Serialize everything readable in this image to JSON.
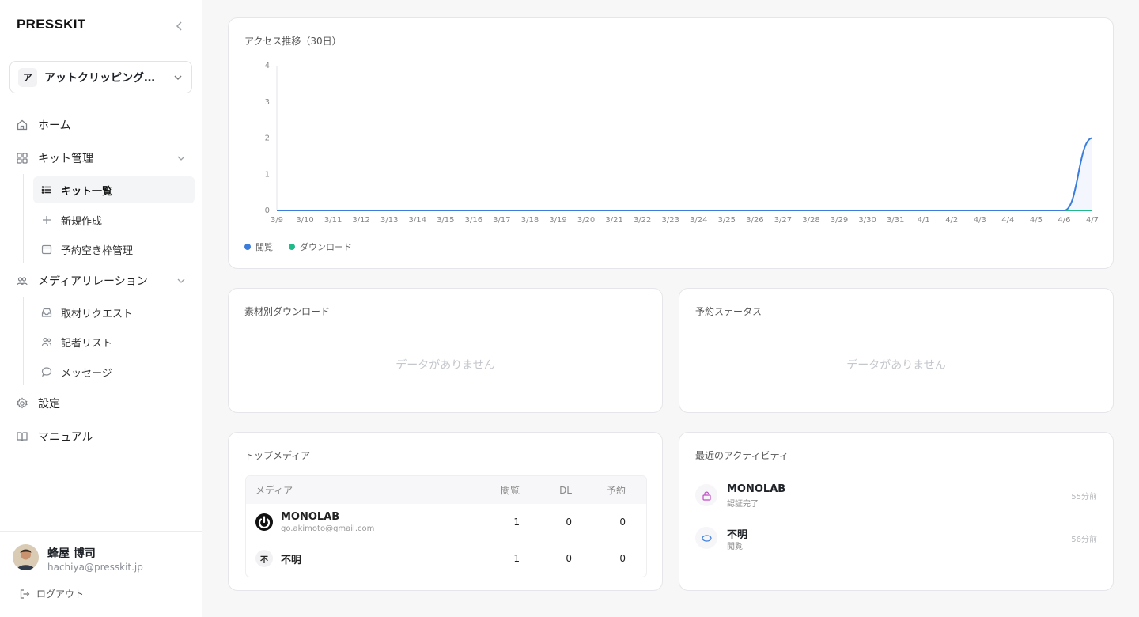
{
  "app": {
    "logo": "PRESSKIT"
  },
  "org": {
    "avatar": "ア",
    "name": "アットクリッピング株式会社"
  },
  "nav": {
    "home": "ホーム",
    "kit_management": "キット管理",
    "kit_list": "キット一覧",
    "new_kit": "新規作成",
    "booking_slots": "予約空き枠管理",
    "media_relations": "メディアリレーション",
    "coverage_requests": "取材リクエスト",
    "journalist_list": "記者リスト",
    "messages": "メッセージ",
    "settings": "設定",
    "manual": "マニュアル"
  },
  "user": {
    "name": "蜂屋 博司",
    "email": "hachiya@presskit.jp",
    "logout": "ログアウト"
  },
  "access_card": {
    "title": "アクセス推移（30日）",
    "legend_views": "閲覧",
    "legend_downloads": "ダウンロード"
  },
  "chart_data": {
    "type": "line",
    "title": "アクセス推移（30日）",
    "x": [
      "3/9",
      "3/10",
      "3/11",
      "3/12",
      "3/13",
      "3/14",
      "3/15",
      "3/16",
      "3/17",
      "3/18",
      "3/19",
      "3/20",
      "3/21",
      "3/22",
      "3/23",
      "3/24",
      "3/25",
      "3/26",
      "3/27",
      "3/28",
      "3/29",
      "3/30",
      "3/31",
      "4/1",
      "4/2",
      "4/3",
      "4/4",
      "4/5",
      "4/6",
      "4/7"
    ],
    "ylim": [
      0,
      4
    ],
    "yticks": [
      0,
      1,
      2,
      3,
      4
    ],
    "series": [
      {
        "name": "閲覧",
        "color": "#3b7ddd",
        "values": [
          0,
          0,
          0,
          0,
          0,
          0,
          0,
          0,
          0,
          0,
          0,
          0,
          0,
          0,
          0,
          0,
          0,
          0,
          0,
          0,
          0,
          0,
          0,
          0,
          0,
          0,
          0,
          0,
          0,
          2
        ]
      },
      {
        "name": "ダウンロード",
        "color": "#1fb98a",
        "values": [
          0,
          0,
          0,
          0,
          0,
          0,
          0,
          0,
          0,
          0,
          0,
          0,
          0,
          0,
          0,
          0,
          0,
          0,
          0,
          0,
          0,
          0,
          0,
          0,
          0,
          0,
          0,
          0,
          0,
          0
        ]
      }
    ],
    "grid": false,
    "legend": "bottom-left"
  },
  "downloads_card": {
    "title": "素材別ダウンロード",
    "empty": "データがありません"
  },
  "booking_card": {
    "title": "予約ステータス",
    "empty": "データがありません"
  },
  "top_media": {
    "title": "トップメディア",
    "headers": {
      "media": "メディア",
      "views": "閲覧",
      "dl": "DL",
      "booking": "予約"
    },
    "rows": [
      {
        "name": "MONOLAB",
        "email": "go.akimoto@gmail.com",
        "views": "1",
        "dl": "0",
        "booking": "0",
        "logo": "power-icon"
      },
      {
        "name": "不明",
        "avatar": "不",
        "views": "1",
        "dl": "0",
        "booking": "0"
      }
    ]
  },
  "activity": {
    "title": "最近のアクティビティ",
    "items": [
      {
        "name": "MONOLAB",
        "sub": "認証完了",
        "time": "55分前",
        "icon": "unlock-icon",
        "color": "#c34bc9"
      },
      {
        "name": "不明",
        "sub": "閲覧",
        "time": "56分前",
        "icon": "eye-icon",
        "color": "#3b7ddd"
      }
    ]
  }
}
